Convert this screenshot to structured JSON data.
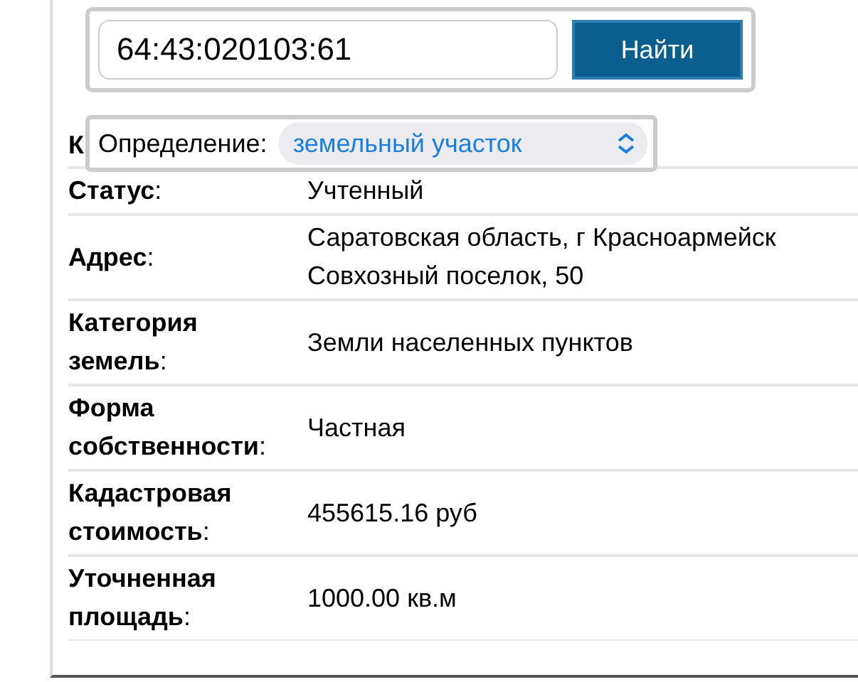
{
  "search": {
    "value": "64:43:020103:61",
    "button": "Найти"
  },
  "definition": {
    "label": "Определение:",
    "value": "земельный участок"
  },
  "rows": [
    {
      "label": "**К**",
      "lines": []
    },
    {
      "label": "**Статус**:",
      "lines": [
        "Учтенный"
      ]
    },
    {
      "label": "**Адрес**:",
      "lines": [
        "Саратовская область, г Красноармейск",
        "Совхозный поселок, 50"
      ]
    },
    {
      "label": "**Категория земель**:",
      "lines": [
        "Земли населенных пунктов"
      ]
    },
    {
      "label": "**Форма собственности**:",
      "lines": [
        "Частная"
      ]
    },
    {
      "label": "**Кадастровая стоимость**:",
      "lines": [
        "455615.16 руб"
      ]
    },
    {
      "label": "**Уточненная площадь**:",
      "lines": [
        "1000.00 кв.м"
      ]
    }
  ]
}
